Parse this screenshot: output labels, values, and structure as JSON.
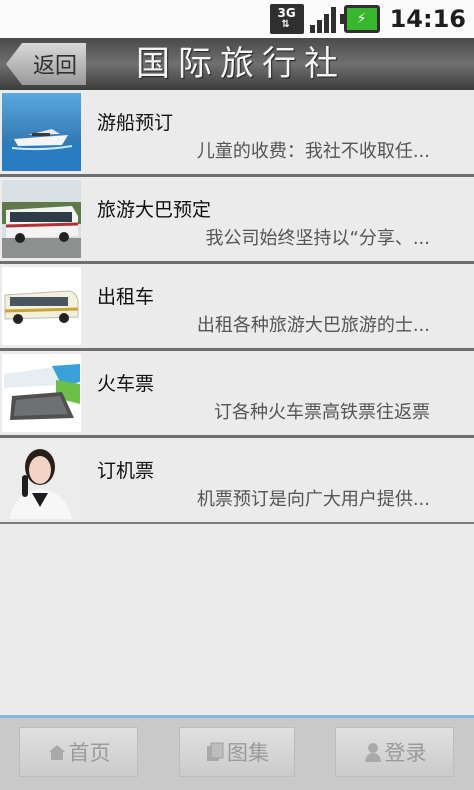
{
  "status_bar": {
    "network": "3G",
    "time": "14:16"
  },
  "header": {
    "back_label": "返回",
    "title": "国际旅行社"
  },
  "list": [
    {
      "title": "游船预订",
      "subtitle": "儿童的收费：我社不收取任..."
    },
    {
      "title": "旅游大巴预定",
      "subtitle": "我公司始终坚持以“分享、..."
    },
    {
      "title": "出租车",
      "subtitle": "出租各种旅游大巴旅游的士..."
    },
    {
      "title": "火车票",
      "subtitle": "订各种火车票高铁票往返票"
    },
    {
      "title": "订机票",
      "subtitle": "机票预订是向广大用户提供..."
    }
  ],
  "bottom_tabs": [
    {
      "label": "首页",
      "icon": "home-icon"
    },
    {
      "label": "图集",
      "icon": "gallery-icon"
    },
    {
      "label": "登录",
      "icon": "user-icon"
    }
  ],
  "colors": {
    "title_bar": "#4a4a4a",
    "bottom_accent": "#7fb7e6",
    "battery": "#38b62d"
  }
}
